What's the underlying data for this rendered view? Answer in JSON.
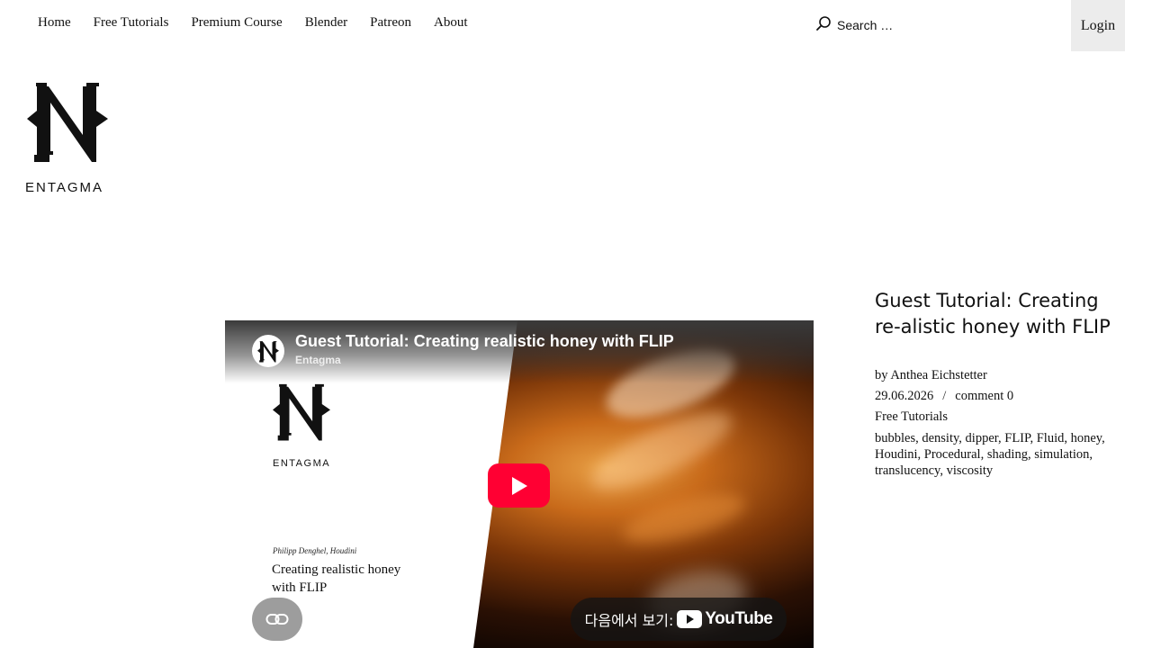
{
  "nav": {
    "items": [
      {
        "label": "Home"
      },
      {
        "label": "Free Tutorials"
      },
      {
        "label": "Premium Course"
      },
      {
        "label": "Blender"
      },
      {
        "label": "Patreon"
      },
      {
        "label": "About"
      }
    ],
    "search_placeholder": "Search …",
    "login_label": "Login"
  },
  "logo": {
    "wordmark": "ENTAGMA"
  },
  "video": {
    "title": "Guest Tutorial: Creating realistic honey with FLIP",
    "channel": "Entagma",
    "inner_wordmark": "ENTAGMA",
    "caption_small": "Philipp Denghel, Houdini",
    "caption_big": "Creating realistic honey with FLIP",
    "watch_on_label": "다음에서 보기:",
    "platform": "YouTube",
    "accent_color": "#ff0033"
  },
  "post": {
    "title": "Guest Tutorial: Creating re-alistic honey with FLIP",
    "author": "by Anthea Eichstetter",
    "date": "29.06.2026",
    "separator": "/",
    "comments": "comment 0",
    "category": "Free Tutorials",
    "tags": "bubbles, density, dipper, FLIP, Fluid, honey, Houdini, Procedural, shading, simulation, translucency, viscosity"
  }
}
